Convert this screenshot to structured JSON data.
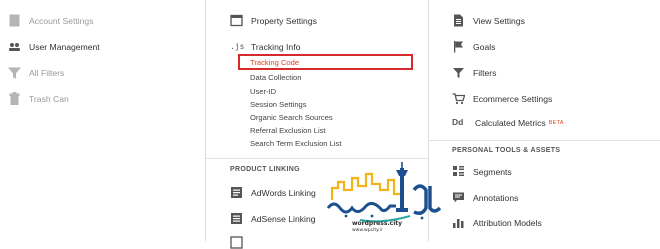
{
  "account": {
    "items": [
      {
        "label": "Account Settings",
        "icon": "building-icon"
      },
      {
        "label": "User Management",
        "icon": "users-icon"
      },
      {
        "label": "All Filters",
        "icon": "filter-icon"
      },
      {
        "label": "Trash Can",
        "icon": "trash-icon"
      }
    ]
  },
  "property": {
    "settings_label": "Property Settings",
    "tracking_info_label": "Tracking Info",
    "tracking_subitems": [
      "Tracking Code",
      "Data Collection",
      "User-ID",
      "Session Settings",
      "Organic Search Sources",
      "Referral Exclusion List",
      "Search Term Exclusion List"
    ],
    "product_linking_header": "PRODUCT LINKING",
    "adwords_label": "AdWords Linking",
    "adsense_label": "AdSense Linking"
  },
  "view": {
    "items": [
      {
        "label": "View Settings",
        "icon": "document-icon"
      },
      {
        "label": "Goals",
        "icon": "flag-icon"
      },
      {
        "label": "Filters",
        "icon": "filter-icon"
      },
      {
        "label": "Ecommerce Settings",
        "icon": "cart-icon"
      },
      {
        "label": "Calculated Metrics",
        "icon": "dd-icon",
        "badge": "BETA"
      }
    ],
    "personal_header": "PERSONAL TOOLS & ASSETS",
    "personal_items": [
      {
        "label": "Segments",
        "icon": "segments-icon"
      },
      {
        "label": "Annotations",
        "icon": "annotation-icon"
      },
      {
        "label": "Attribution Models",
        "icon": "bar-chart-icon"
      }
    ]
  },
  "watermark": {
    "text": "wordpress.city",
    "subtext": "www.wpcity.ir",
    "colors": {
      "yellow": "#f2b418",
      "blue": "#1b4f8f",
      "teal": "#2aa6a6"
    }
  },
  "colors": {
    "accent": "#e0431f",
    "highlight": "#d82a2a"
  }
}
